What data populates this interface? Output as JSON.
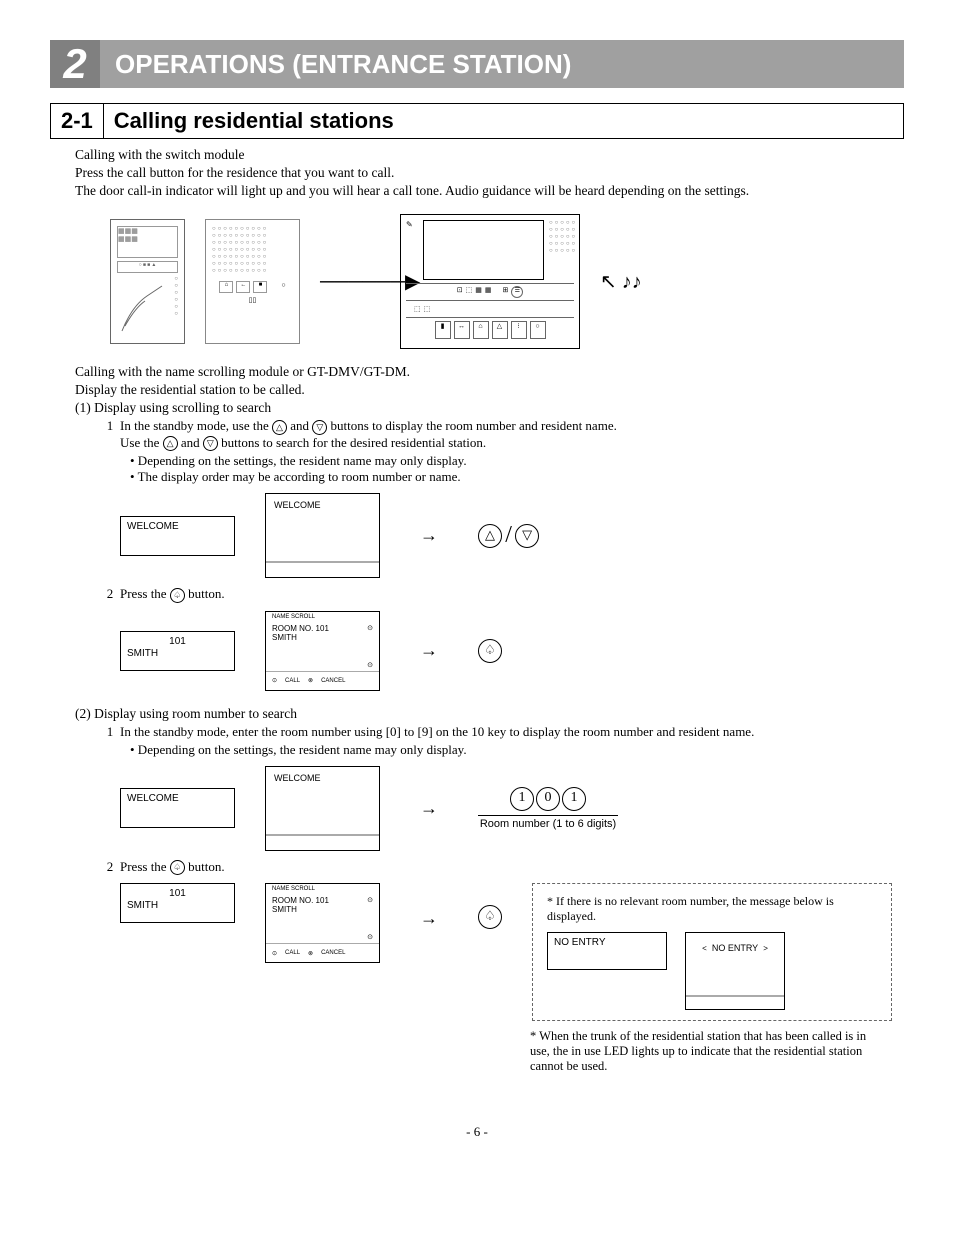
{
  "chapter": {
    "num": "2",
    "title": "OPERATIONS (ENTRANCE STATION)"
  },
  "section": {
    "num": "2-1",
    "title": "Calling residential stations"
  },
  "p1": "Calling with the switch module",
  "p2": "Press the call button for the residence that you want to call.",
  "p3": "The door call-in indicator will light up and you will hear a call tone. Audio guidance will be heard depending on the settings.",
  "p4": "Calling with the name scrolling module or GT-DMV/GT-DM.",
  "p5": "Display the residential station to be called.",
  "p6": "(1) Display using scrolling to search",
  "step1a_num": "1",
  "step1a": "In the standby mode, use the",
  "step1b": "and",
  "step1c": "buttons to display the room number and resident name.",
  "step1d": "Use the",
  "step1e": "and",
  "step1f": "buttons to search for the desired residential station.",
  "bullet1": "•  Depending on the settings, the resident name may only display.",
  "bullet2": "•  The display order may be according to room number or name.",
  "lcd_welcome": "WELCOME",
  "step2_num": "2",
  "step2": "Press the",
  "step2b": "button.",
  "lcd_101": "101",
  "lcd_smith": "SMITH",
  "lcd_name_scroll": "NAME SCROLL",
  "lcd_room_no": "ROOM NO. 101",
  "lcd_call": "CALL",
  "lcd_cancel": "CANCEL",
  "p7": "(2) Display using room number to search",
  "step3_num": "1",
  "step3": "In the standby mode, enter the room number using [0] to [9] on the 10 key to display the room number and resident name.",
  "bullet3": "•  Depending on the settings, the resident name may only display.",
  "digits": [
    "1",
    "0",
    "1"
  ],
  "digits_caption": "Room number (1 to 6 digits)",
  "step4_num": "2",
  "step4": "Press the",
  "step4b": "button.",
  "footnote_head": "* If there is no relevant room number, the message below is displayed.",
  "no_entry": "NO ENTRY",
  "no_entry_nav": "< NO ENTRY >",
  "asterisk_note": "* When the trunk of the residential station that has been called is in use, the in use LED lights up to indicate that the residential station cannot be used.",
  "page_num": "- 6 -"
}
